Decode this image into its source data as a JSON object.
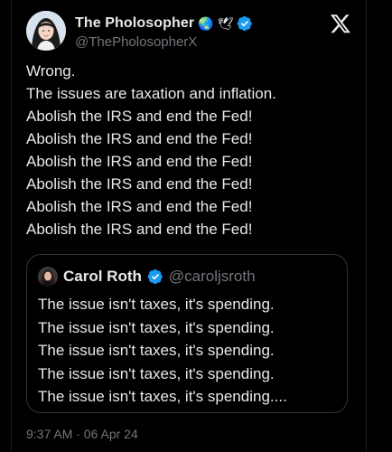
{
  "post": {
    "author_name": "The Pholosopher",
    "author_emojis": [
      "🌏",
      "🕊"
    ],
    "author_handle": "@ThePholosopherX",
    "verified": true,
    "lines": [
      "Wrong.",
      "The issues are taxation and inflation.",
      "Abolish the IRS and end the Fed!",
      "Abolish the IRS and end the Fed!",
      "Abolish the IRS and end the Fed!",
      "Abolish the IRS and end the Fed!",
      "Abolish the IRS and end the Fed!",
      "Abolish the IRS and end the Fed!"
    ],
    "timestamp": "9:37 AM · 06 Apr 24"
  },
  "quote": {
    "author_name": "Carol Roth",
    "author_handle": "@caroljsroth",
    "verified": true,
    "lines": [
      "The issue isn't taxes, it's spending.",
      "The issue isn't taxes, it's spending.",
      "The issue isn't taxes, it's spending.",
      "The issue isn't taxes, it's spending.",
      "The issue isn't taxes, it's spending...."
    ]
  },
  "icons": {
    "brand": "x-logo-icon",
    "verified": "verified-badge-icon"
  },
  "colors": {
    "background": "#000000",
    "text": "#e7e9ea",
    "muted": "#71767b",
    "verified": "#1d9bf0",
    "border": "#2f3336"
  }
}
